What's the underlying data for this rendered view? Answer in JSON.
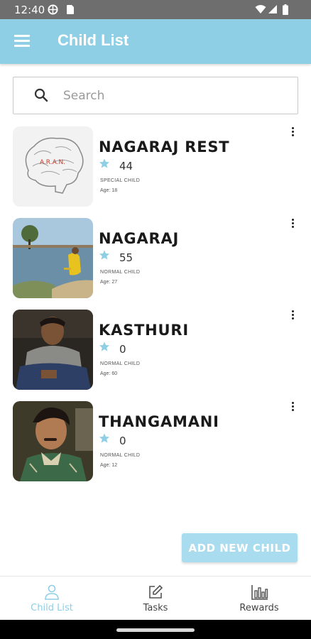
{
  "status_bar": {
    "time": "12:40"
  },
  "app_bar": {
    "title": "Child List",
    "menu_icon": "hamburger-menu-icon"
  },
  "search": {
    "placeholder": "Search",
    "value": "",
    "icon": "search-icon"
  },
  "children": [
    {
      "name": "NAGARAJ REST",
      "points": "44",
      "type": "SPECIAL CHILD",
      "age_label": "Age:",
      "age": "18",
      "photo_text": "A.R.A.N."
    },
    {
      "name": "NAGARAJ",
      "points": "55",
      "type": "NORMAL CHILD",
      "age_label": "Age:",
      "age": "27"
    },
    {
      "name": "KASTHURI",
      "points": "0",
      "type": "NORMAL CHILD",
      "age_label": "Age:",
      "age": "60"
    },
    {
      "name": "THANGAMANI",
      "points": "0",
      "type": "NORMAL CHILD",
      "age_label": "Age:",
      "age": "12"
    }
  ],
  "add_button": {
    "label": "ADD NEW CHILD"
  },
  "bottom_nav": [
    {
      "label": "Child List",
      "icon": "person-icon",
      "active": true
    },
    {
      "label": "Tasks",
      "icon": "edit-icon",
      "active": false
    },
    {
      "label": "Rewards",
      "icon": "bar-chart-icon",
      "active": false
    }
  ],
  "colors": {
    "accent": "#8ecfe6",
    "button": "#a9dcee",
    "status_bar": "#6e6e6e"
  }
}
